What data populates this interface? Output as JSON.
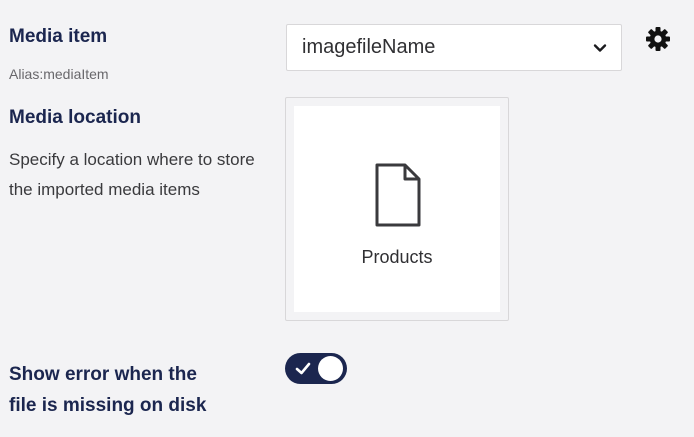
{
  "media_item": {
    "label": "Media item",
    "alias": "Alias:mediaItem",
    "selected_value": "imagefileName",
    "settings_icon": "gear-icon",
    "dropdown_icon": "chevron-down-icon"
  },
  "media_location": {
    "label": "Media location",
    "description": "Specify a location where to store the imported media items",
    "item_name": "Products",
    "item_icon": "document-icon"
  },
  "show_error": {
    "label_line1": "Show error when the",
    "label_line2": "file is missing on disk",
    "toggle_state": "on",
    "toggle_icon": "checkmark-icon"
  },
  "colors": {
    "accent": "#1b264f",
    "background": "#f3f3f5",
    "muted_text": "#68676b"
  }
}
